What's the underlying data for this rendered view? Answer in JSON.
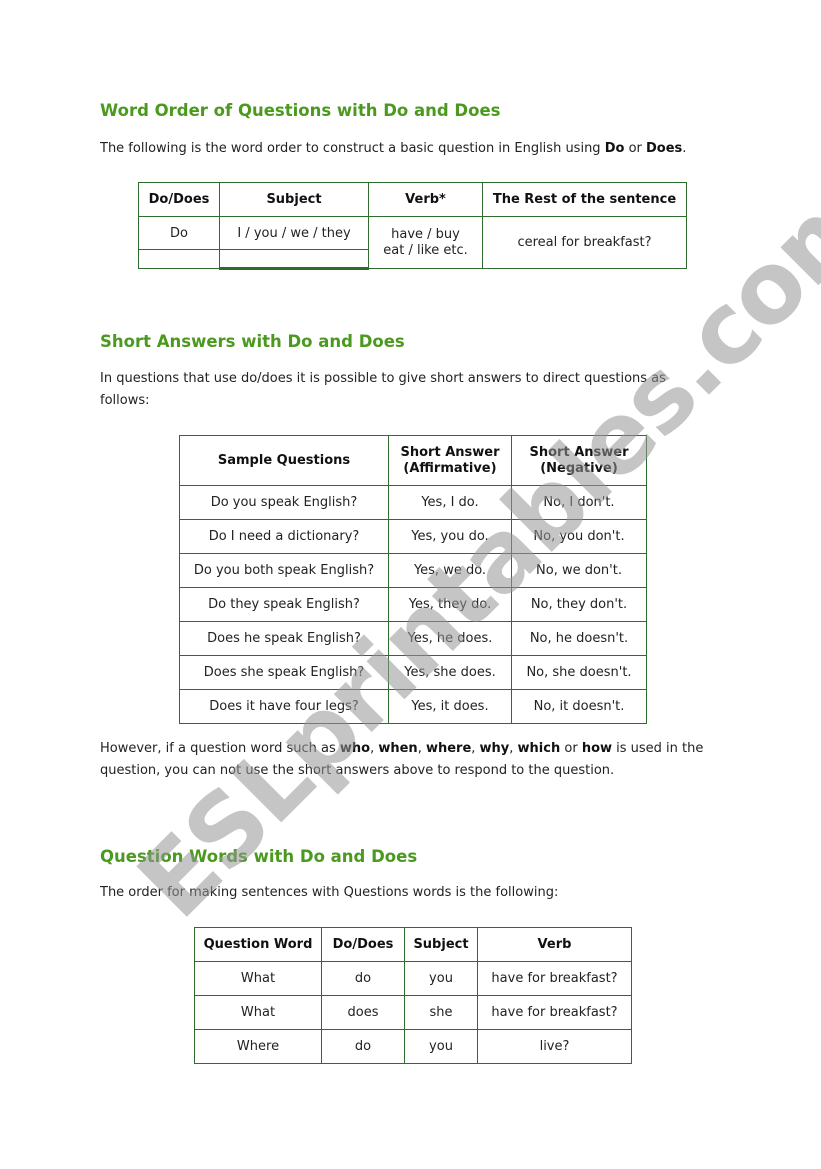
{
  "section1": {
    "title": "Word Order of Questions with Do and Does",
    "intro_prefix": "The following is the word order to construct a basic question in English using ",
    "intro_bold1": "Do",
    "intro_mid": " or ",
    "intro_bold2": "Does",
    "intro_suffix": ".",
    "table": {
      "headers": [
        "Do/Does",
        "Subject",
        "Verb*",
        "The Rest of the sentence"
      ],
      "row": {
        "do_does": "Do",
        "subject": "I / you / we / they",
        "verb_line1": "have / buy",
        "verb_line2": "eat / like etc.",
        "rest": "cereal for breakfast?"
      }
    }
  },
  "section2": {
    "title": "Short Answers with Do and Does",
    "intro": "In questions that use do/does it is possible to give short answers to direct questions as follows:",
    "table": {
      "headers": [
        "Sample Questions",
        "Short Answer",
        "(Affirmative)",
        "Short Answer",
        "(Negative)"
      ],
      "rows": [
        [
          "Do you speak English?",
          "Yes, I do.",
          "No, I don't."
        ],
        [
          "Do I need a dictionary?",
          "Yes, you do.",
          "No, you don't."
        ],
        [
          "Do you both speak English?",
          "Yes, we do.",
          "No, we don't."
        ],
        [
          "Do they speak English?",
          "Yes, they do.",
          "No, they don't."
        ],
        [
          "Does he speak English?",
          "Yes, he does.",
          "No, he doesn't."
        ],
        [
          "Does she speak English?",
          "Yes, she does.",
          "No, she doesn't."
        ],
        [
          "Does it have four legs?",
          "Yes, it does.",
          "No, it doesn't."
        ]
      ]
    },
    "note": {
      "t1": "However, if a question word such as ",
      "b1": "who",
      "t2": ", ",
      "b2": "when",
      "t3": ", ",
      "b3": "where",
      "t4": ", ",
      "b4": "why",
      "t5": ", ",
      "b5": "which",
      "t6": " or ",
      "b6": "how",
      "t7": " is used in the question, you can not use the short answers above to respond to the question."
    }
  },
  "section3": {
    "title": "Question Words with Do and Does",
    "intro": "The order for making sentences with Questions words is the following:",
    "table": {
      "headers": [
        "Question Word",
        "Do/Does",
        "Subject",
        "Verb"
      ],
      "rows": [
        [
          "What",
          "do",
          "you",
          "have for breakfast?"
        ],
        [
          "What",
          "does",
          "she",
          "have for breakfast?"
        ],
        [
          "Where",
          "do",
          "you",
          "live?"
        ]
      ]
    }
  },
  "watermark": "ESLprintables.com",
  "colors": {
    "heading": "#4b9a1f",
    "table_border": "#2f6b2f",
    "watermark": "#969696"
  }
}
